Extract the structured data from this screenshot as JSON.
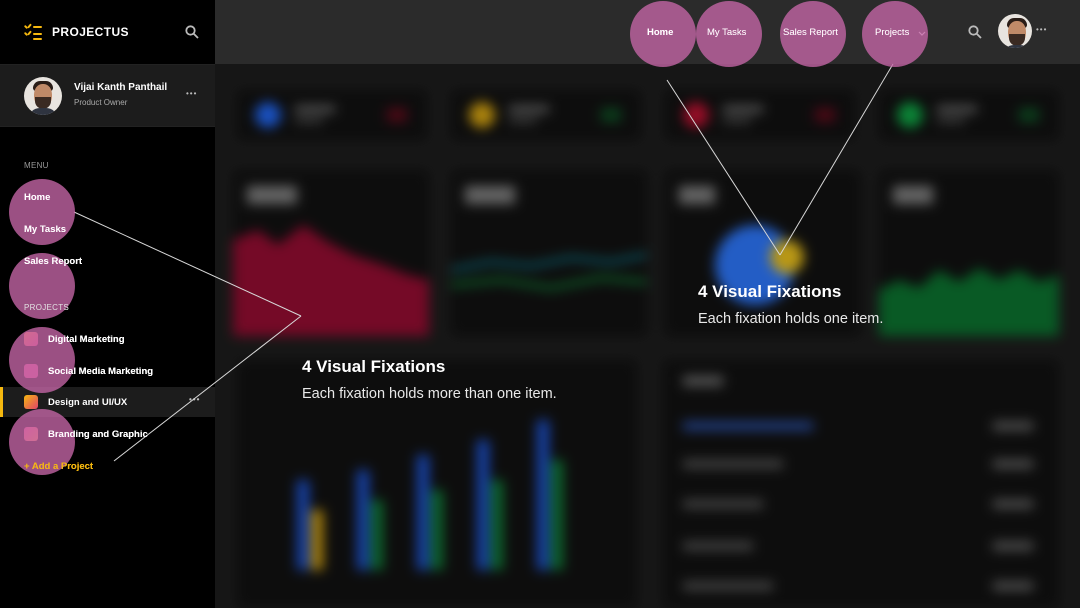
{
  "app": {
    "brand": "PROJECTUS"
  },
  "profile": {
    "name": "Vijai Kanth Panthail",
    "role": "Product Owner",
    "more": "•••"
  },
  "sidebar": {
    "menu_title": "MENU",
    "menu": [
      "Home",
      "My Tasks",
      "Sales Report"
    ],
    "projects_title": "PROJECTS",
    "projects": [
      "Digital Marketing",
      "Social Media Marketing",
      "Design and UI/UX",
      "Branding and Graphic"
    ],
    "active_project_more": "•••",
    "add_project": "+ Add a Project"
  },
  "topnav": {
    "items": [
      "Home",
      "My Tasks",
      "Sales Report",
      "Projects"
    ],
    "more": "•••"
  },
  "annotations": {
    "left": {
      "title": "4 Visual Fixations",
      "subtitle": "Each fixation holds more than one item."
    },
    "right": {
      "title": "4 Visual Fixations",
      "subtitle": "Each fixation holds one item."
    }
  },
  "colors": {
    "accent": "#f5b80f",
    "fixation": "#c666a8",
    "sidebar": "#000000",
    "background": "#262626"
  }
}
